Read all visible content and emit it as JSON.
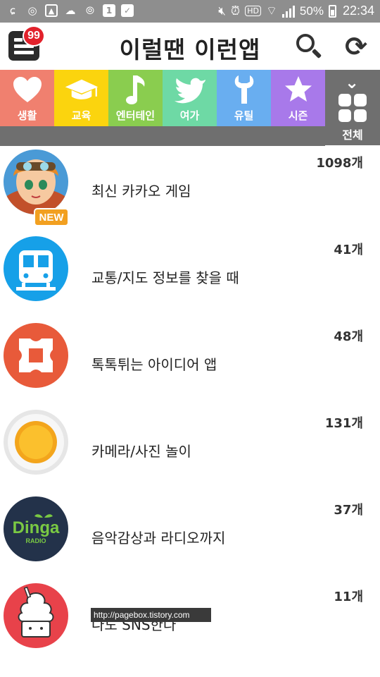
{
  "status_bar": {
    "battery": "50%",
    "time": "22:34",
    "left_icons": [
      "g-icon",
      "o-icon",
      "gallery-icon",
      "cloud-icon",
      "wifi-calling-icon",
      "one-icon",
      "bag-icon"
    ],
    "right_icons": [
      "mute-icon",
      "alarm-icon",
      "hd-icon",
      "wifi-icon",
      "signal-icon",
      "battery-icon"
    ]
  },
  "header": {
    "title": "이럴땐 이런앱",
    "badge_count": "99"
  },
  "tabs": [
    {
      "label": "생활",
      "color": "#f0806f",
      "icon": "heart-icon"
    },
    {
      "label": "교육",
      "color": "#fbd40e",
      "icon": "graduation-cap-icon"
    },
    {
      "label": "엔터테인",
      "color": "#8acd4f",
      "icon": "music-note-icon"
    },
    {
      "label": "여가",
      "color": "#6ed9a5",
      "icon": "bird-icon"
    },
    {
      "label": "유틸",
      "color": "#69aef0",
      "icon": "wrench-icon"
    },
    {
      "label": "시즌",
      "color": "#a879ea",
      "icon": "star-icon"
    }
  ],
  "tab_all": {
    "label": "전체"
  },
  "list": [
    {
      "count": "1098개",
      "name": "최신 카카오 게임",
      "badge": "NEW"
    },
    {
      "count": "41개",
      "name": "교통/지도 정보를 찾을 때"
    },
    {
      "count": "48개",
      "name": "톡톡튀는 아이디어 앱"
    },
    {
      "count": "131개",
      "name": "카메라/사진 놀이"
    },
    {
      "count": "37개",
      "name": "음악감상과 라디오까지"
    },
    {
      "count": "11개",
      "name": "나도 SNS한다"
    }
  ],
  "thumb_texts": {
    "dinga": "Dinga",
    "radio": "RADIO"
  },
  "watermark": "http://pagebox.tistory.com"
}
